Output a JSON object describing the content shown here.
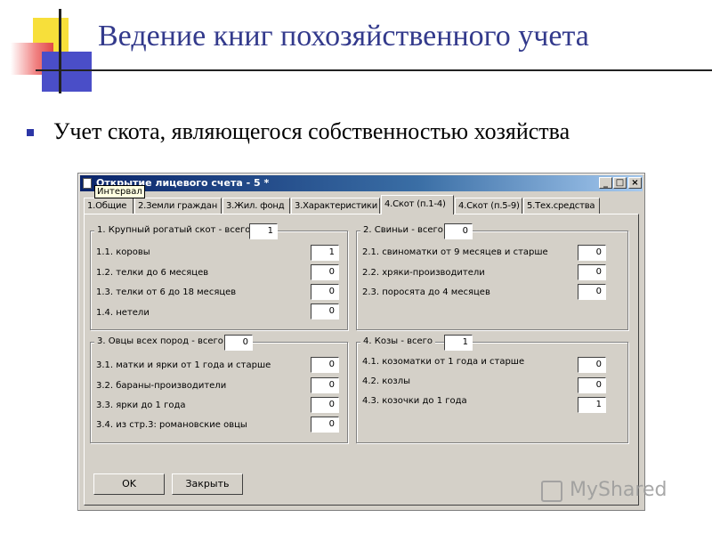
{
  "slide": {
    "title": "Ведение книг похозяйственного учета",
    "bullet": "Учет скота, являющегося собственностью хозяйства"
  },
  "window": {
    "title": "Открытие лицевого счета - 5 *",
    "tooltip": "Интервал",
    "controls": {
      "minimize": "_",
      "maximize": "□",
      "close": "×"
    },
    "tabs": [
      "1.Общие",
      "2.Земли граждан",
      "3.Жил. фонд",
      "3.Характеристики",
      "4.Скот (п.1-4)",
      "4.Скот (п.5-9)",
      "5.Тех.средства"
    ],
    "active_tab": "4.Скот (п.1-4)"
  },
  "groups": {
    "cattle": {
      "title": "1. Крупный рогатый скот - всего",
      "total": "1",
      "rows": [
        {
          "label": "1.1. коровы",
          "value": "1"
        },
        {
          "label": "1.2. телки до 6 месяцев",
          "value": "0"
        },
        {
          "label": "1.3. телки от 6 до 18 месяцев",
          "value": "0"
        },
        {
          "label": "1.4. нетели",
          "value": "0"
        }
      ]
    },
    "pigs": {
      "title": "2. Свиньи - всего",
      "total": "0",
      "rows": [
        {
          "label": "2.1. свиноматки от 9 месяцев и старше",
          "value": "0"
        },
        {
          "label": "2.2. хряки-производители",
          "value": "0"
        },
        {
          "label": "2.3. поросята до 4 месяцев",
          "value": "0"
        }
      ]
    },
    "sheep": {
      "title": "3. Овцы всех пород - всего",
      "total": "0",
      "rows": [
        {
          "label": "3.1. матки и ярки от 1 года и старше",
          "value": "0"
        },
        {
          "label": "3.2. бараны-производители",
          "value": "0"
        },
        {
          "label": "3.3. ярки до 1 года",
          "value": "0"
        },
        {
          "label": "3.4. из стр.3: романовские овцы",
          "value": "0"
        }
      ]
    },
    "goats": {
      "title": "4. Козы - всего",
      "total": "1",
      "rows": [
        {
          "label": "4.1. козоматки от 1 года и старше",
          "value": "0"
        },
        {
          "label": "4.2. козлы",
          "value": "0"
        },
        {
          "label": "4.3. козочки до 1 года",
          "value": "1"
        }
      ]
    }
  },
  "buttons": {
    "ok": "OK",
    "close": "Закрыть"
  },
  "watermark": "MyShared"
}
